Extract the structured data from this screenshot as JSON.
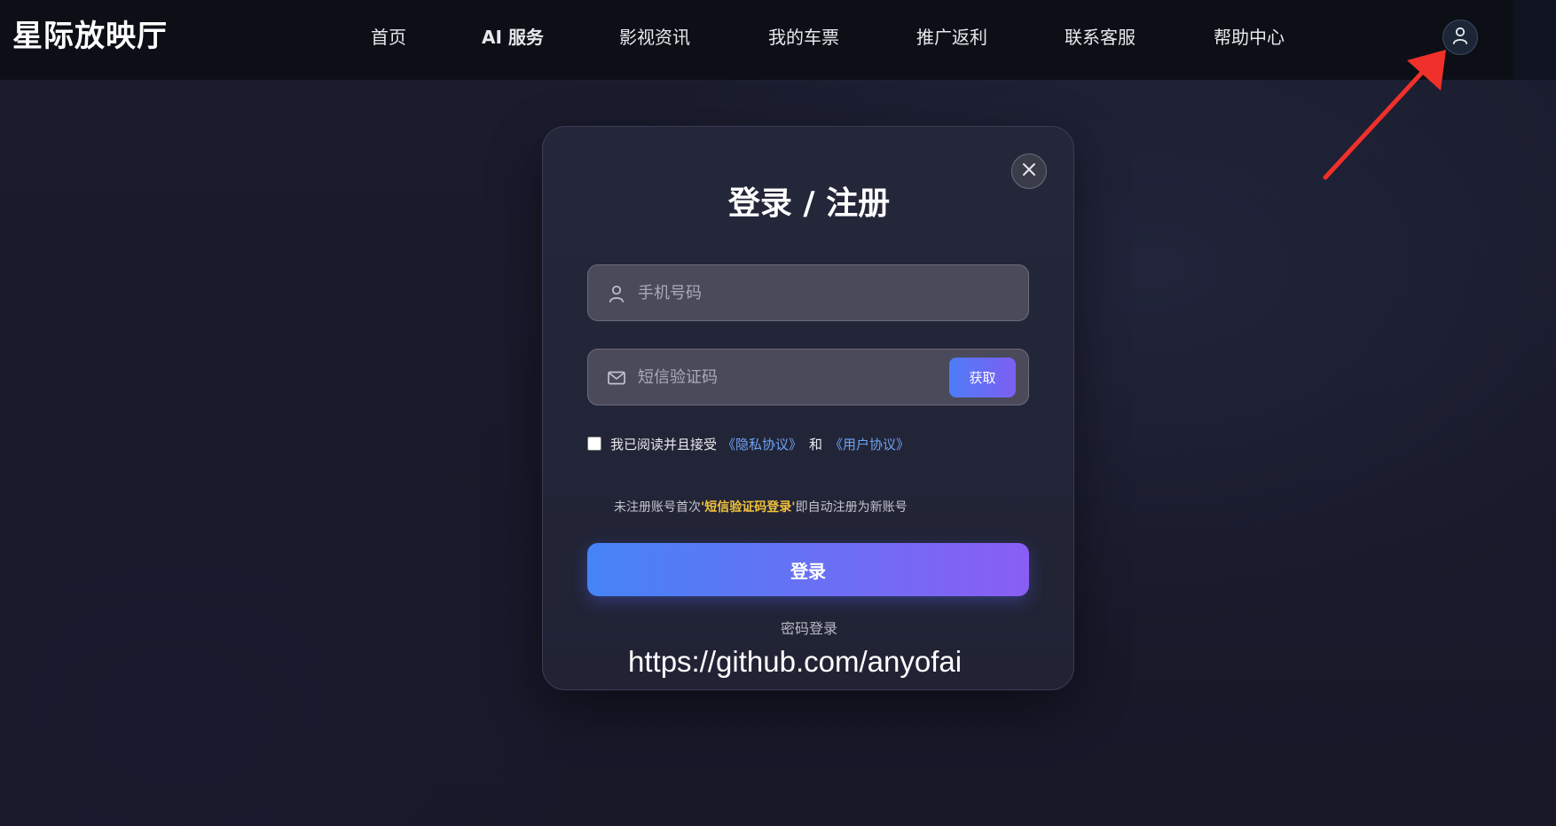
{
  "brand": "星际放映厅",
  "nav": {
    "items": [
      {
        "label": "首页",
        "bold": false
      },
      {
        "label": "AI 服务",
        "bold": true
      },
      {
        "label": "影视资讯",
        "bold": false
      },
      {
        "label": "我的车票",
        "bold": false
      },
      {
        "label": "推广返利",
        "bold": false
      },
      {
        "label": "联系客服",
        "bold": false
      },
      {
        "label": "帮助中心",
        "bold": false
      }
    ],
    "avatar_icon": "user-icon"
  },
  "modal": {
    "title": "登录 / 注册",
    "phone": {
      "placeholder": "手机号码",
      "value": "",
      "icon": "user-icon"
    },
    "sms": {
      "placeholder": "短信验证码",
      "value": "",
      "icon": "mail-icon",
      "get_code_label": "获取"
    },
    "agreement": {
      "checked": false,
      "prefix": "我已阅读并且接受",
      "privacy_link": "《隐私协议》",
      "and": "和",
      "user_link": "《用户协议》"
    },
    "hint": {
      "before": "未注册账号首次",
      "highlight": "'短信验证码登录'",
      "after": "即自动注册为新账号"
    },
    "login_label": "登录",
    "password_login_label": "密码登录",
    "watermark": "https://github.com/anyofai"
  },
  "colors": {
    "accent_start": "#4584f6",
    "accent_end": "#8a5ef4",
    "link": "#6ea2f2",
    "highlight": "#f2c23a",
    "annotation_arrow": "#f0302a"
  }
}
